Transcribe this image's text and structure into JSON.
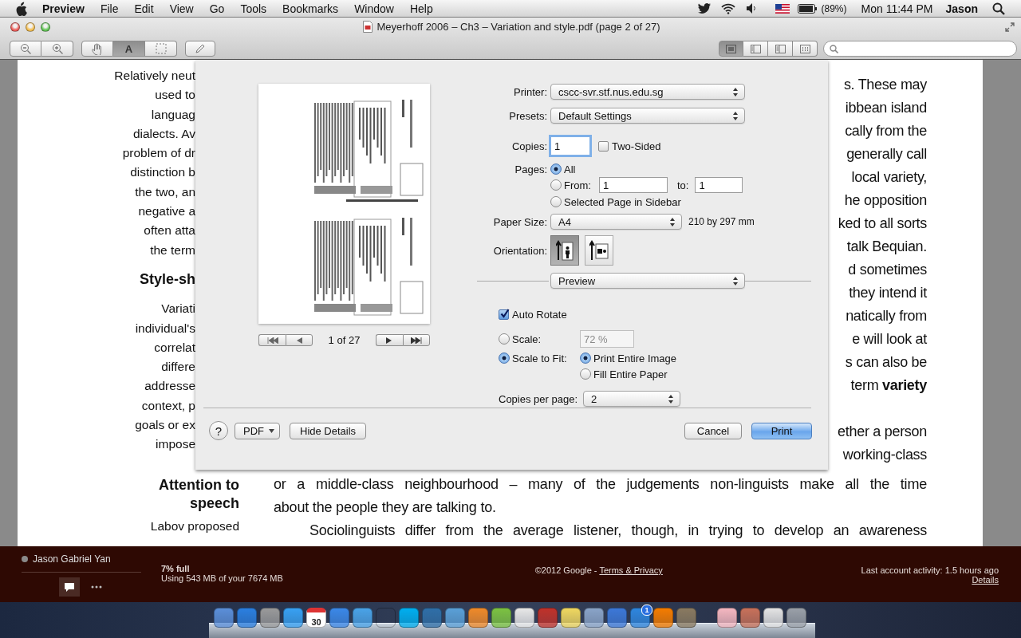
{
  "menu_bar": {
    "app": "Preview",
    "menus": [
      "File",
      "Edit",
      "View",
      "Go",
      "Tools",
      "Bookmarks",
      "Window",
      "Help"
    ],
    "battery": "(89%)",
    "clock": "Mon 11:44 PM",
    "user": "Jason"
  },
  "window": {
    "title": "Meyerhoff 2006 – Ch3 – Variation and style.pdf (page 2 of 27)",
    "toolbar": {
      "tools": [
        {
          "kind": "hand",
          "selected": false
        },
        {
          "kind": "text",
          "glyph": "A",
          "selected": true
        },
        {
          "kind": "select",
          "selected": false
        }
      ],
      "view_modes": [
        {
          "kind": "content",
          "selected": true
        },
        {
          "kind": "thumbnails",
          "selected": false
        },
        {
          "kind": "contents",
          "selected": false
        },
        {
          "kind": "contact_sheet",
          "selected": false
        }
      ]
    },
    "document": {
      "margin_beside": [
        {
          "kind": "line",
          "text": "Relatively neut"
        },
        {
          "kind": "line",
          "text": "used to"
        },
        {
          "kind": "line",
          "text": "languag"
        },
        {
          "kind": "line",
          "text": "dialects. Av"
        },
        {
          "kind": "line",
          "text": "problem of dr"
        },
        {
          "kind": "line",
          "text": "distinction b"
        },
        {
          "kind": "line",
          "text": "the two, an"
        },
        {
          "kind": "line",
          "text": "negative a"
        },
        {
          "kind": "line",
          "text": "often atta"
        },
        {
          "kind": "line",
          "text": "the term"
        },
        {
          "kind": "heading",
          "text": "Style-sh"
        },
        {
          "kind": "line",
          "text": "Variati"
        },
        {
          "kind": "line",
          "text": "individual's"
        },
        {
          "kind": "line",
          "text": "correlat"
        },
        {
          "kind": "line",
          "text": "differe"
        },
        {
          "kind": "line",
          "text": "addresse"
        },
        {
          "kind": "line",
          "text": "context, p"
        },
        {
          "kind": "line",
          "text": "goals or ex"
        },
        {
          "kind": "line",
          "text": "impose"
        }
      ],
      "margin_below": [
        {
          "kind": "heading",
          "text": "Attention to speech"
        },
        {
          "kind": "line",
          "text": "Labov proposed"
        }
      ],
      "body_beside": [
        [
          "s. These may",
          "ibbean island",
          "cally from the",
          "generally call",
          "local variety,",
          "he opposition",
          "ked to all sorts",
          "talk Bequian.",
          "d sometimes",
          "they intend it",
          "natically from",
          "e will look at",
          "s can also be",
          "term **variety**"
        ],
        [
          "ether a person",
          "working-class"
        ]
      ],
      "body_below": [
        {
          "text": "or a middle-class neighbourhood – many of the judgements non-linguists make all the time",
          "indent": false,
          "last_line": false
        },
        {
          "text": "about the people they are talking to.",
          "indent": false,
          "last_line": true
        },
        {
          "text": "Sociolinguists differ from the average listener, though, in trying to develop an awareness",
          "indent": true,
          "last_line": false
        }
      ]
    }
  },
  "print_dialog": {
    "page_counter": "1 of 27",
    "printer": {
      "label": "Printer:",
      "value": "cscc-svr.stf.nus.edu.sg"
    },
    "presets": {
      "label": "Presets:",
      "value": "Default Settings"
    },
    "copies": {
      "label": "Copies:",
      "value": "1",
      "focused": true
    },
    "two_sided": {
      "label": "Two-Sided",
      "checked": false
    },
    "pages": {
      "label": "Pages:",
      "all": {
        "label": "All",
        "selected": true
      },
      "range": {
        "label": "From:",
        "selected": false,
        "from": "1",
        "to_label": "to:",
        "to": "1"
      },
      "sidebar": {
        "label": "Selected Page in Sidebar",
        "selected": false
      }
    },
    "paper_size": {
      "label": "Paper Size:",
      "value": "A4",
      "dimensions": "210 by 297 mm"
    },
    "orientation": {
      "label": "Orientation:",
      "options": [
        {
          "kind": "portrait",
          "selected": true
        },
        {
          "kind": "landscape",
          "selected": false
        }
      ]
    },
    "section": "Preview",
    "auto_rotate": {
      "label": "Auto Rotate",
      "checked": true
    },
    "scale": {
      "label": "Scale:",
      "selected": false,
      "value": "72 %",
      "disabled": true
    },
    "scale_to_fit": {
      "label": "Scale to Fit:",
      "selected": true,
      "options": [
        {
          "label": "Print Entire Image",
          "selected": true
        },
        {
          "label": "Fill Entire Paper",
          "selected": false
        }
      ]
    },
    "copies_per_page": {
      "label": "Copies per page:",
      "value": "2"
    },
    "left_buttons": [
      {
        "kind": "help",
        "label": "?"
      },
      {
        "kind": "menu",
        "label": "PDF"
      },
      {
        "kind": "plain",
        "label": "Hide Details"
      }
    ],
    "right_buttons": [
      {
        "kind": "plain",
        "label": "Cancel"
      },
      {
        "kind": "default",
        "label": "Print"
      }
    ]
  },
  "background_page": {
    "chat_user": "Jason Gabriel Yan",
    "storage_used": "7% full",
    "storage_detail": "Using 543 MB of your 7674 MB",
    "copyright": "©2012 Google - ",
    "terms_link": "Terms & Privacy",
    "last_activity": "Last account activity: 1.5 hours ago",
    "details_link": "Details"
  },
  "dock": {
    "calendar_day": "30",
    "badge": "1"
  }
}
